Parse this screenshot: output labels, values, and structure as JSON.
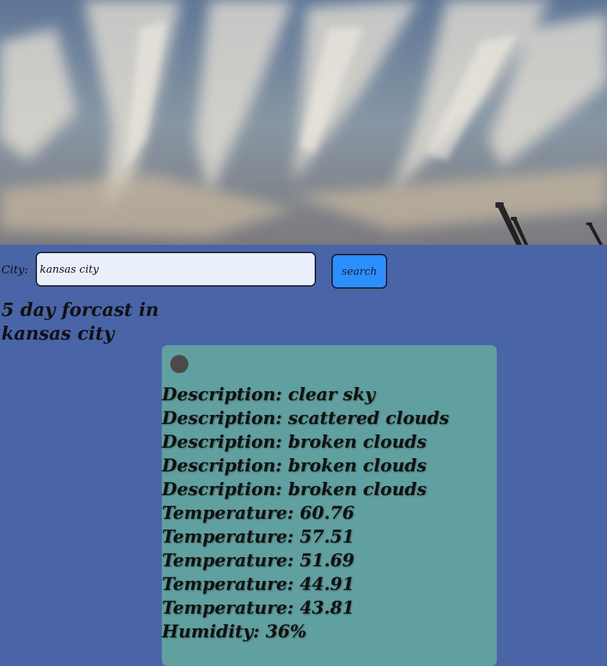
{
  "search": {
    "label": "City:",
    "value": "kansas city",
    "button_label": "search"
  },
  "forecast": {
    "heading": "5 day forcast in kansas city",
    "descriptions": [
      "Description: clear sky",
      "Description: scattered clouds",
      "Description: broken clouds",
      "Description: broken clouds",
      "Description: broken clouds"
    ],
    "temperatures": [
      "Temperature: 60.76",
      "Temperature: 57.51",
      "Temperature: 51.69",
      "Temperature: 44.91",
      "Temperature: 43.81"
    ],
    "humidity": [
      "Humidity: 36%"
    ]
  },
  "icons": {
    "weather": "weather-icon"
  },
  "colors": {
    "page_background": "#4a64a8",
    "card_background": "#61a0a0",
    "button_background": "#2b8ffd",
    "input_background": "#eaf0fb"
  }
}
